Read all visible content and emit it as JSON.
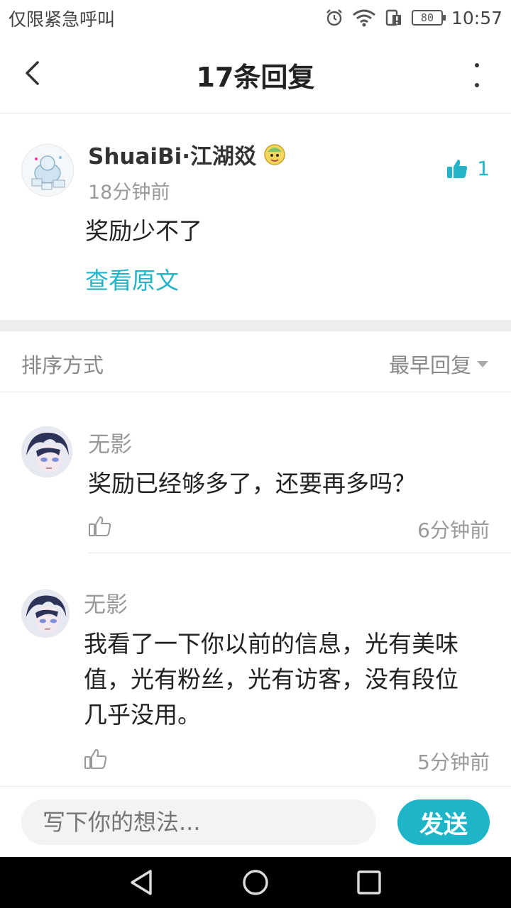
{
  "status_bar": {
    "carrier": "仅限紧急呼叫",
    "battery": "80",
    "time": "10:57"
  },
  "header": {
    "title": "17条回复"
  },
  "original_comment": {
    "username": "ShuaiBi·江湖㸚",
    "time": "18分钟前",
    "like_count": "1",
    "body": "奖励少不了",
    "view_original": "查看原文"
  },
  "sort": {
    "label": "排序方式",
    "selected": "最早回复"
  },
  "replies": [
    {
      "name": "无影",
      "text": "奖励已经够多了，还要再多吗？",
      "time": "6分钟前"
    },
    {
      "name": "无影",
      "text": "我看了一下你以前的信息，光有美味值，光有粉丝，光有访客，没有段位几乎没用。",
      "time": "5分钟前"
    }
  ],
  "composer": {
    "placeholder": "写下你的想法...",
    "send_label": "发送"
  },
  "colors": {
    "accent": "#1fb5c8",
    "link": "#23b4c8"
  }
}
